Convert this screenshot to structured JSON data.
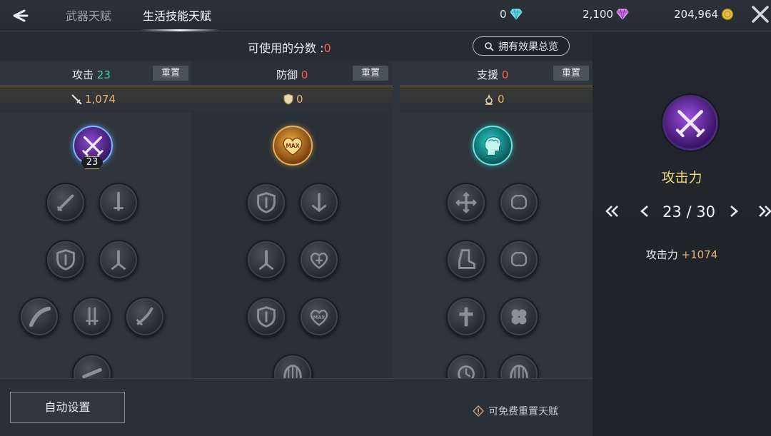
{
  "header": {
    "tabs": [
      {
        "label": "武器天赋",
        "active": false
      },
      {
        "label": "生活技能天赋",
        "active": true
      }
    ],
    "currencies": [
      {
        "icon": "diamond-icon",
        "value": "0",
        "color": "#5ad8e8"
      },
      {
        "icon": "purple-gem-icon",
        "value": "2,100",
        "color": "#d070e8"
      },
      {
        "icon": "gold-coin-icon",
        "value": "204,964",
        "color": "#e8c040"
      }
    ]
  },
  "points": {
    "label": "可使用的分数 :",
    "value": "0"
  },
  "overview_button": "拥有效果总览",
  "columns": [
    {
      "name": "攻击",
      "points": "23",
      "reset": "重置",
      "stat_icon": "sword-icon",
      "stat_value": "1,074"
    },
    {
      "name": "防御",
      "points": "0",
      "reset": "重置",
      "stat_icon": "shield-icon",
      "stat_value": "0"
    },
    {
      "name": "支援",
      "points": "0",
      "reset": "重置",
      "stat_icon": "support-icon",
      "stat_value": "0"
    }
  ],
  "top_node_level": "23",
  "bottom": {
    "auto_button": "自动设置",
    "free_reset": "可免费重置天赋"
  },
  "detail": {
    "title": "攻击力",
    "page_current": "23",
    "page_total": "30",
    "page_text": "23 / 30",
    "stat_name": "攻击力",
    "stat_bonus": "+1074"
  }
}
